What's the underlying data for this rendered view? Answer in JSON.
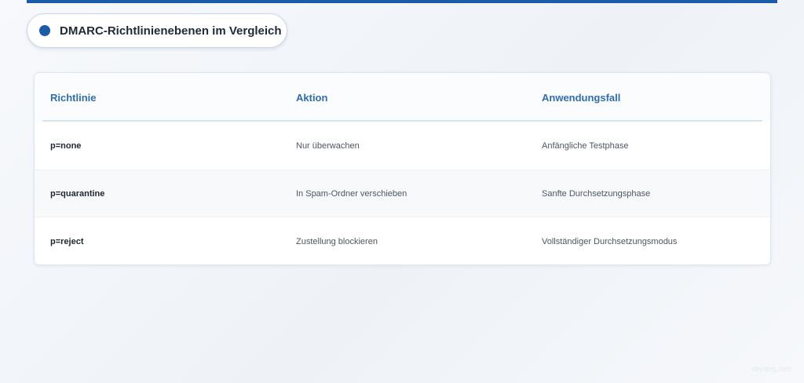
{
  "header": {
    "title": "DMARC-Richtlinienebenen im Vergleich"
  },
  "table": {
    "columns": [
      "Richtlinie",
      "Aktion",
      "Anwendungsfall"
    ],
    "rows": [
      [
        "p=none",
        "Nur überwachen",
        "Anfängliche Testphase"
      ],
      [
        "p=quarantine",
        "In Spam-Ordner verschieben",
        "Sanfte Durchsetzungsphase"
      ],
      [
        "p=reject",
        "Zustellung blockieren",
        "Vollständiger Durchsetzungsmodus"
      ]
    ]
  },
  "footer": {
    "watermark": "skyvorg.com"
  },
  "colors": {
    "accent": "#1b5ca8",
    "header_text": "#2f6db3",
    "border": "#d6e3f1"
  }
}
